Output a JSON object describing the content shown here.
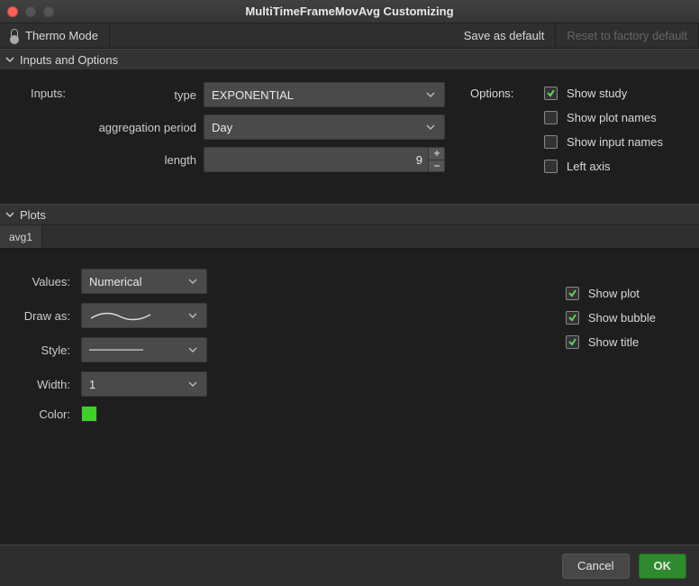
{
  "window": {
    "title": "MultiTimeFrameMovAvg Customizing"
  },
  "toolbar": {
    "thermo": "Thermo Mode",
    "save_default": "Save as default",
    "reset_factory": "Reset to factory default"
  },
  "sections": {
    "inputs_options": "Inputs and Options",
    "plots": "Plots"
  },
  "inputs": {
    "label": "Inputs:",
    "type_label": "type",
    "type_value": "EXPONENTIAL",
    "agg_label": "aggregation period",
    "agg_value": "Day",
    "length_label": "length",
    "length_value": "9"
  },
  "options": {
    "label": "Options:",
    "show_study": "Show study",
    "show_plot_names": "Show plot names",
    "show_input_names": "Show input names",
    "left_axis": "Left axis"
  },
  "plots": {
    "tab1": "avg1",
    "values_label": "Values:",
    "values_value": "Numerical",
    "drawas_label": "Draw as:",
    "style_label": "Style:",
    "width_label": "Width:",
    "width_value": "1",
    "color_label": "Color:",
    "color_value": "#3fd02a",
    "show_plot": "Show plot",
    "show_bubble": "Show bubble",
    "show_title": "Show title"
  },
  "footer": {
    "cancel": "Cancel",
    "ok": "OK"
  }
}
